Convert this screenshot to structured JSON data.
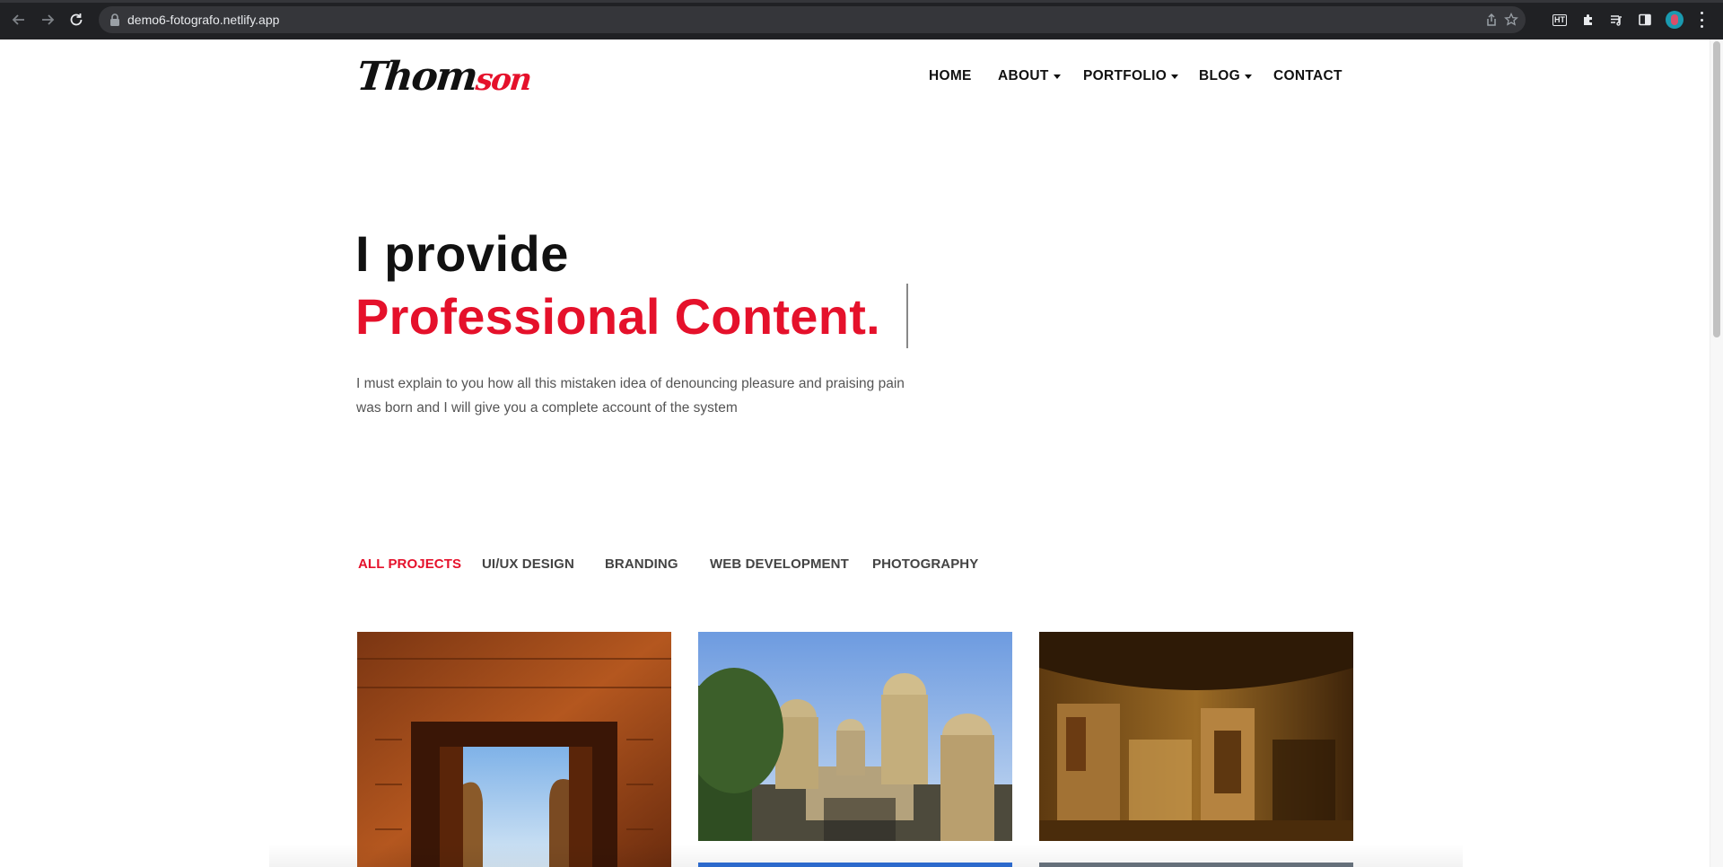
{
  "browser": {
    "url": "demo6-fotografo.netlify.app",
    "extension_label": "HT",
    "icons": [
      "back-arrow-icon",
      "forward-arrow-icon",
      "reload-icon",
      "lock-icon",
      "share-icon",
      "bookmark-star-icon",
      "puzzle-extensions-icon",
      "media-playlist-icon",
      "sidebar-icon",
      "profile-avatar-icon",
      "more-menu-icon"
    ]
  },
  "header": {
    "logo_part1": "Thom",
    "logo_part2": "son",
    "menu": [
      {
        "label": "HOME",
        "dropdown": false
      },
      {
        "label": "ABOUT",
        "dropdown": true
      },
      {
        "label": "PORTFOLIO",
        "dropdown": true
      },
      {
        "label": "BLOG",
        "dropdown": true
      },
      {
        "label": "CONTACT",
        "dropdown": false
      }
    ]
  },
  "hero": {
    "line1": "I provide",
    "line2": "Professional Content.",
    "description_line1": "I must explain to you how all this mistaken idea of denouncing pleasure and praising pain",
    "description_line2": "was born and I will give you a complete account of the system"
  },
  "portfolio": {
    "filters": [
      {
        "label": "ALL PROJECTS",
        "active": true
      },
      {
        "label": "UI/UX DESIGN",
        "active": false
      },
      {
        "label": "BRANDING",
        "active": false
      },
      {
        "label": "WEB DEVELOPMENT",
        "active": false
      },
      {
        "label": "PHOTOGRAPHY",
        "active": false
      }
    ]
  },
  "colors": {
    "accent": "#e5112b",
    "text": "#111111",
    "muted": "#555555",
    "chrome_bg": "#202124"
  }
}
